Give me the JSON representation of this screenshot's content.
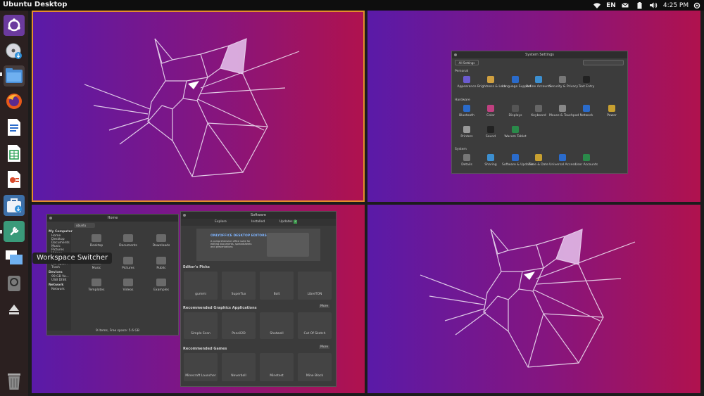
{
  "topbar": {
    "app_title": "Ubuntu Desktop",
    "keyboard_layout": "EN",
    "clock": "4:25 PM"
  },
  "launcher": {
    "items": [
      "ubuntu-logo-icon",
      "dvd-drive-icon",
      "files-icon",
      "firefox-icon",
      "libreoffice-writer-icon",
      "libreoffice-calc-icon",
      "libreoffice-impress-icon",
      "software-center-icon",
      "system-settings-icon",
      "workspace-switcher-icon",
      "disk-icon",
      "eject-icon"
    ],
    "trash": "trash-icon",
    "tooltip": "Workspace Switcher"
  },
  "settings_window": {
    "title": "System Settings",
    "all_settings": "All Settings",
    "sections": [
      {
        "name": "Personal",
        "items": [
          "Appearance",
          "Brightness & Lock",
          "Language Support",
          "Online Accounts",
          "Security & Privacy",
          "Text Entry"
        ]
      },
      {
        "name": "Hardware",
        "items": [
          "Bluetooth",
          "Color",
          "Displays",
          "Keyboard",
          "Mouse & Touchpad",
          "Network",
          "Power",
          "Printers",
          "Sound",
          "Wacom Tablet"
        ]
      },
      {
        "name": "System",
        "items": [
          "Details",
          "Sharing",
          "Software & Updates",
          "Time & Date",
          "Universal Access",
          "User Accounts"
        ]
      }
    ]
  },
  "files_window": {
    "title": "Home",
    "path": "ubuntu",
    "sidebar_heading_computer": "My Computer",
    "sidebar_computer": [
      "Home",
      "Desktop",
      "Documents",
      "Music",
      "Pictures",
      "Videos",
      "Downloads",
      "Recent",
      "File Syst...",
      "Trash"
    ],
    "sidebar_heading_devices": "Devices",
    "sidebar_devices": [
      "99 GB Vo...",
      "USB DISK"
    ],
    "sidebar_heading_network": "Network",
    "sidebar_network": [
      "Network"
    ],
    "items": [
      "Desktop",
      "Documents",
      "Downloads",
      "Music",
      "Pictures",
      "Public",
      "Templates",
      "Videos",
      "Examples"
    ],
    "status": "9 items, Free space: 5.6 GB"
  },
  "software_window": {
    "title": "Software",
    "tabs": [
      "Explore",
      "Installed",
      "Updates"
    ],
    "updates_badge": "3",
    "banner_title": "ONLYOFFICE DESKTOP EDITORS",
    "banner_sub": "A comprehensive office suite for editing documents, spreadsheets and presentations",
    "section_editors": "Editor's Picks",
    "editors": [
      "gummi",
      "SuperTux",
      "Bolt",
      "LibreTON"
    ],
    "section_graphics": "Recommended Graphics Applications",
    "graphics": [
      "Simple Scan",
      "Pencil2D",
      "Shotwell",
      "Cut Of Sketch"
    ],
    "section_games": "Recommended Games",
    "games": [
      "Minecraft Launcher",
      "Neverball",
      "Minetest",
      "Mine Block"
    ],
    "more": "More"
  }
}
